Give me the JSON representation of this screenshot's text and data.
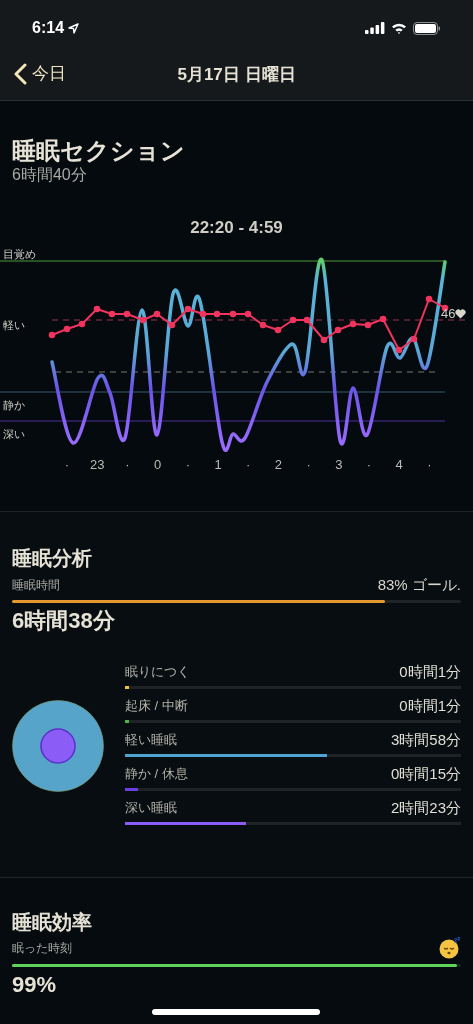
{
  "status_bar": {
    "time": "6:14"
  },
  "nav": {
    "back_label": "今日",
    "title": "5月17日 日曜日"
  },
  "sleep_section": {
    "title": "睡眠セクション",
    "duration": "6時間40分",
    "chart": {
      "time_range": "22:20 - 4:59",
      "stage_labels": [
        "目覚め",
        "軽い",
        "静か",
        "深い"
      ],
      "x_labels": [
        "·",
        "23",
        "·",
        "0",
        "·",
        "1",
        "·",
        "2",
        "·",
        "3",
        "·",
        "4",
        "·"
      ],
      "heart_rate_label": "46"
    }
  },
  "analysis": {
    "title": "睡眠分析",
    "duration_label": "睡眠時間",
    "goal": "83% ゴール.",
    "goal_bar": {
      "level": 0.83
    },
    "duration": "6時間38分",
    "stages": [
      {
        "name": "眠りにつく",
        "value": "0時間1分",
        "level": 0.012,
        "color": "#f2c230"
      },
      {
        "name": "起床 / 中断",
        "value": "0時間1分",
        "level": 0.012,
        "color": "#4cb648"
      },
      {
        "name": "軽い睡眠",
        "value": "3時間58分",
        "level": 0.6,
        "color": "#4ea3d2"
      },
      {
        "name": "静か / 休息",
        "value": "0時間15分",
        "level": 0.04,
        "color": "#6a3fe0"
      },
      {
        "name": "深い睡眠",
        "value": "2時間23分",
        "level": 0.36,
        "color": "#8b5cf6"
      }
    ]
  },
  "efficiency": {
    "title": "睡眠効率",
    "label": "眠った時刻",
    "bar": {
      "level": 0.99
    },
    "value": "99%"
  }
}
